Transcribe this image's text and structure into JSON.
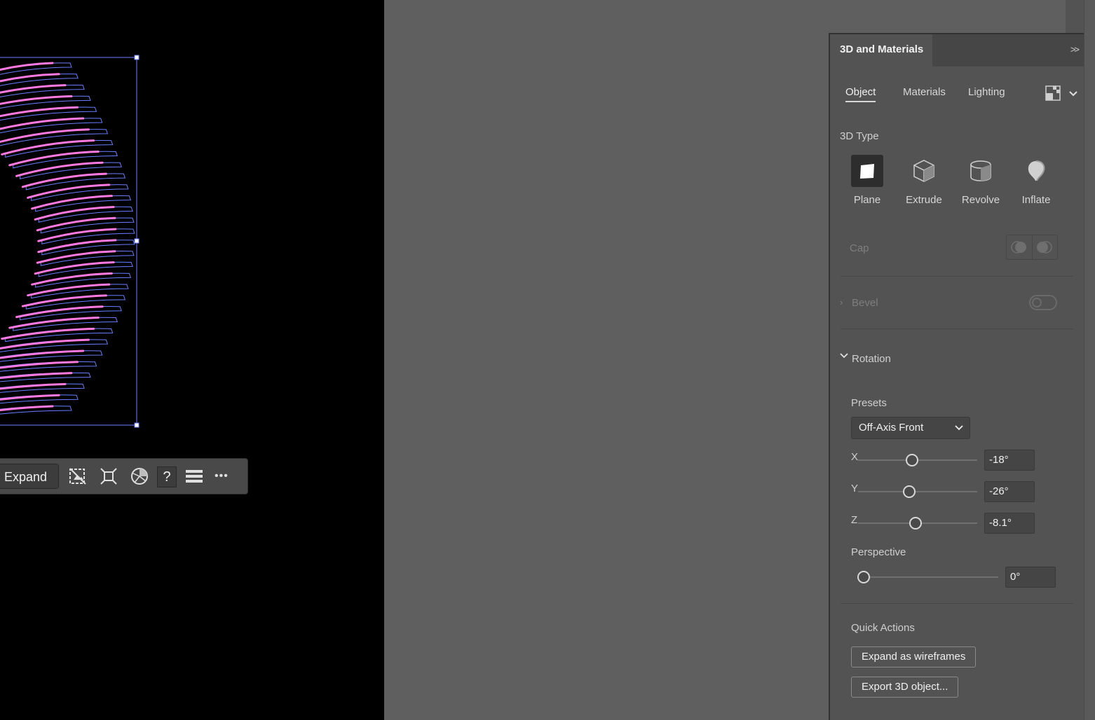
{
  "canvas": {
    "toolbar": {
      "expand_label": "Expand",
      "icons": [
        "hide-artboard-icon",
        "fit-icon",
        "render-sphere-icon",
        "help-icon",
        "menu-icon",
        "more-icon"
      ],
      "help_glyph": "?",
      "more_glyph": "•••"
    }
  },
  "panel": {
    "title": "3D and Materials",
    "collapse_glyph": ">>",
    "tabs": [
      {
        "label": "Object",
        "active": true
      },
      {
        "label": "Materials",
        "active": false
      },
      {
        "label": "Lighting",
        "active": false
      }
    ],
    "type_section": {
      "label": "3D Type",
      "types": [
        {
          "label": "Plane",
          "selected": true,
          "icon": "plane-icon"
        },
        {
          "label": "Extrude",
          "selected": false,
          "icon": "extrude-icon"
        },
        {
          "label": "Revolve",
          "selected": false,
          "icon": "revolve-icon"
        },
        {
          "label": "Inflate",
          "selected": false,
          "icon": "inflate-icon"
        }
      ]
    },
    "cap_label": "Cap",
    "bevel": {
      "label": "Bevel",
      "enabled": false
    },
    "rotation": {
      "label": "Rotation",
      "presets_label": "Presets",
      "preset_value": "Off-Axis Front",
      "x": {
        "axis": "X",
        "value": "-18°",
        "fraction": 0.45
      },
      "y": {
        "axis": "Y",
        "value": "-26°",
        "fraction": 0.43
      },
      "z": {
        "axis": "Z",
        "value": "-8.1°",
        "fraction": 0.48
      },
      "perspective_label": "Perspective",
      "perspective": {
        "value": "0°",
        "fraction": 0.0
      }
    },
    "quick_actions": {
      "label": "Quick Actions",
      "expand_wireframes": "Expand as wireframes",
      "export_3d": "Export 3D object..."
    }
  },
  "colors": {
    "canvas_bg": "#000000",
    "workspace_bg": "#5f5f5f",
    "panel_bg": "#535353",
    "selection_blue": "#6b7fff",
    "stroke_pink": "#ff7ae0"
  }
}
